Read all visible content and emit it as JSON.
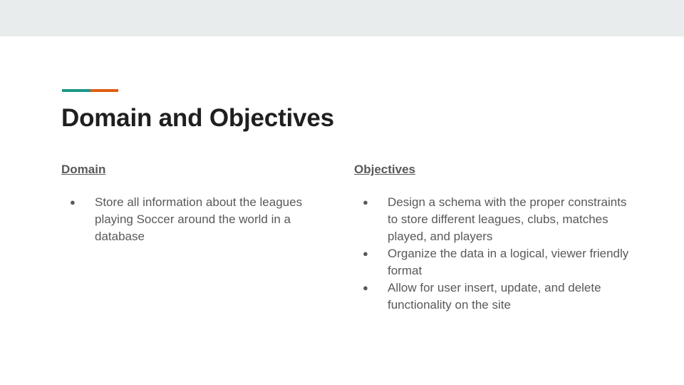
{
  "theme": {
    "accent_teal": "#1a9887",
    "accent_orange": "#e35d0f",
    "band_color": "#e9ecec",
    "text_color": "#595959",
    "title_color": "#1f1f1f"
  },
  "slide": {
    "title": "Domain and Objectives",
    "columns": [
      {
        "heading": "Domain",
        "bullets": [
          "Store all information about the leagues playing Soccer around the world in a database"
        ]
      },
      {
        "heading": "Objectives",
        "bullets": [
          "Design a schema with the proper constraints to store different leagues, clubs, matches played, and players",
          "Organize the data in a logical, viewer friendly format",
          "Allow for user insert, update, and delete functionality on the site"
        ]
      }
    ]
  }
}
